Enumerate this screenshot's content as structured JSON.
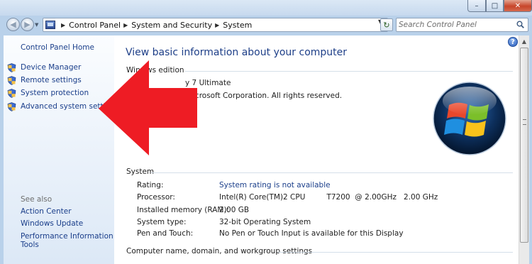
{
  "window": {
    "buttons": {
      "minimize": "–",
      "maximize": "□",
      "close": "✕"
    }
  },
  "toolbar": {
    "breadcrumbs": [
      "Control Panel",
      "System and Security",
      "System"
    ],
    "search": {
      "placeholder": "Search Control Panel"
    },
    "icons": [
      "back-icon",
      "forward-icon",
      "control-panel-icon",
      "refresh-icon",
      "search-icon"
    ]
  },
  "sidebar": {
    "home": "Control Panel Home",
    "tasks": [
      {
        "label": "Device Manager",
        "icon": "shield-icon"
      },
      {
        "label": "Remote settings",
        "icon": "shield-icon"
      },
      {
        "label": "System protection",
        "icon": "shield-icon"
      },
      {
        "label": "Advanced system settings",
        "icon": "shield-icon"
      }
    ],
    "see_also": "See also",
    "see_also_links": [
      "Action Center",
      "Windows Update",
      "Performance Information and",
      "Tools"
    ]
  },
  "main": {
    "help": "?",
    "title": "View basic information about your computer",
    "edition_head_left": "Win",
    "edition_head_right": "ws edition",
    "edition_name_fragment": "y 7 Ultimate",
    "copyright_fragment": "icrosoft Corporation.  All rights reserved.",
    "system_head": "System",
    "system_rows": [
      {
        "label": "Rating:",
        "value": "System rating is not available",
        "link": true
      },
      {
        "label": "Processor:",
        "value": "Intel(R) Core(TM)2 CPU         T7200  @ 2.00GHz   2.00 GHz",
        "link": false
      },
      {
        "label": "Installed memory (RAM):",
        "value": "2.00 GB",
        "link": false
      },
      {
        "label": "System type:",
        "value": "32-bit Operating System",
        "link": false
      },
      {
        "label": "Pen and Touch:",
        "value": "No Pen or Touch Input is available for this Display",
        "link": false
      }
    ],
    "computer_name_head": "Computer name, domain, and workgroup settings"
  },
  "colors": {
    "link": "#1a3e8a",
    "title": "#1e3f88",
    "arrow": "#ee1c24",
    "window_frame": "#b9d1ea"
  }
}
